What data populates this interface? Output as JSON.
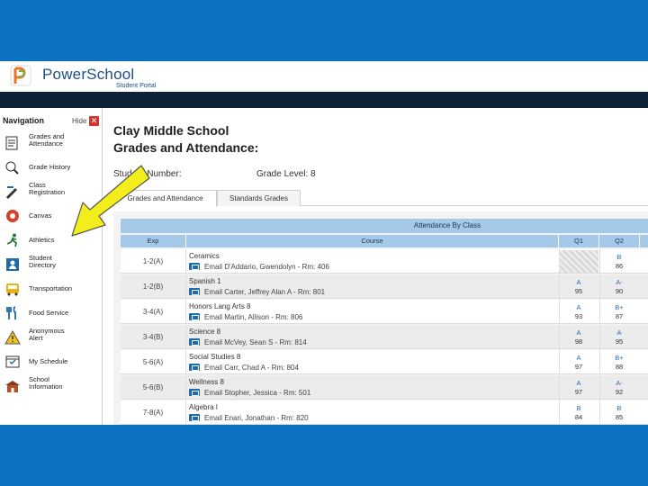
{
  "app": {
    "brand": "PowerSchool",
    "subtitle": "Student Portal"
  },
  "nav": {
    "title": "Navigation",
    "hide_label": "Hide",
    "items": [
      {
        "label": "Grades and\nAttendance",
        "icon": "grades-icon"
      },
      {
        "label": "Grade History",
        "icon": "history-icon"
      },
      {
        "label": "Class\nRegistration",
        "icon": "pencil-icon"
      },
      {
        "label": "Canvas",
        "icon": "canvas-icon"
      },
      {
        "label": "Athletics",
        "icon": "runner-icon"
      },
      {
        "label": "Student\nDirectory",
        "icon": "directory-icon"
      },
      {
        "label": "Transportation",
        "icon": "bus-icon"
      },
      {
        "label": "Food Service",
        "icon": "utensils-icon"
      },
      {
        "label": "Anonymous\nAlert",
        "icon": "alert-icon"
      },
      {
        "label": "My Schedule",
        "icon": "schedule-icon"
      },
      {
        "label": "School\nInformation",
        "icon": "school-icon"
      }
    ]
  },
  "main": {
    "school": "Clay Middle School",
    "title": "Grades and Attendance:",
    "student_number_label": "Student Number:",
    "grade_level_label": "Grade Level: 8",
    "tabs": [
      "Grades and Attendance",
      "Standards Grades"
    ],
    "table": {
      "title": "Attendance By Class",
      "headers": {
        "exp": "Exp",
        "course": "Course",
        "q1": "Q1",
        "q2": "Q2"
      },
      "rows": [
        {
          "exp": "1-2(A)",
          "course": "Ceramics",
          "teacher": "Email D'Addario, Gwendolyn - Rm: 406",
          "q1_letter": "",
          "q1_pct": "",
          "q2_letter": "B",
          "q2_pct": "86"
        },
        {
          "exp": "1-2(B)",
          "course": "Spanish 1",
          "teacher": "Email Carter, Jeffrey Alan A - Rm: 801",
          "q1_letter": "A",
          "q1_pct": "95",
          "q2_letter": "A-",
          "q2_pct": "90"
        },
        {
          "exp": "3-4(A)",
          "course": "Honors Lang Arts 8",
          "teacher": "Email Martin, Allison - Rm: 806",
          "q1_letter": "A",
          "q1_pct": "93",
          "q2_letter": "B+",
          "q2_pct": "87"
        },
        {
          "exp": "3-4(B)",
          "course": "Science 8",
          "teacher": "Email McVey, Sean S - Rm: 814",
          "q1_letter": "A",
          "q1_pct": "98",
          "q2_letter": "A",
          "q2_pct": "95"
        },
        {
          "exp": "5-6(A)",
          "course": "Social Studies 8",
          "teacher": "Email Carr, Chad A - Rm: 804",
          "q1_letter": "A",
          "q1_pct": "97",
          "q2_letter": "B+",
          "q2_pct": "88"
        },
        {
          "exp": "5-6(B)",
          "course": "Wellness 8",
          "teacher": "Email Stopher, Jessica - Rm: 501",
          "q1_letter": "A",
          "q1_pct": "97",
          "q2_letter": "A-",
          "q2_pct": "92"
        },
        {
          "exp": "7-8(A)",
          "course": "Algebra I",
          "teacher": "Email Enari, Jonathan - Rm: 820",
          "q1_letter": "B",
          "q1_pct": "84",
          "q2_letter": "B",
          "q2_pct": "85"
        }
      ]
    }
  },
  "colors": {
    "frame": "#0b72c1",
    "header_bar": "#0e2338",
    "table_header": "#a5c9e9",
    "arrow": "#f2ee1c",
    "grade_link": "#2a6ab2"
  }
}
